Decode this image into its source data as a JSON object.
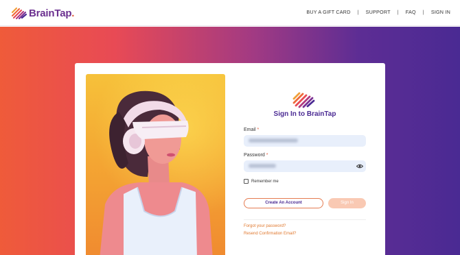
{
  "header": {
    "logo": {
      "name": "BrainTap",
      "text_main": "BrainTap",
      "text_dot": "."
    },
    "nav": [
      {
        "label": "BUY A GIFT CARD"
      },
      {
        "label": "SUPPORT"
      },
      {
        "label": "FAQ"
      },
      {
        "label": "SIGN IN"
      }
    ],
    "separator": "|"
  },
  "signin": {
    "title": "Sign In to BrainTap",
    "email_label": "Email",
    "password_label": "Password",
    "required_mark": "*",
    "remember_label": "Remember me",
    "create_account_label": "Create An Account",
    "signin_label": "Sign In",
    "forgot_password_link": "Forgot your password?",
    "resend_confirmation_link": "Resend Confirmation Email?"
  },
  "colors": {
    "brand_purple": "#4a2a93",
    "brand_orange": "#e35a3a",
    "link_orange": "#e0782e",
    "input_bg": "#e8effb"
  }
}
